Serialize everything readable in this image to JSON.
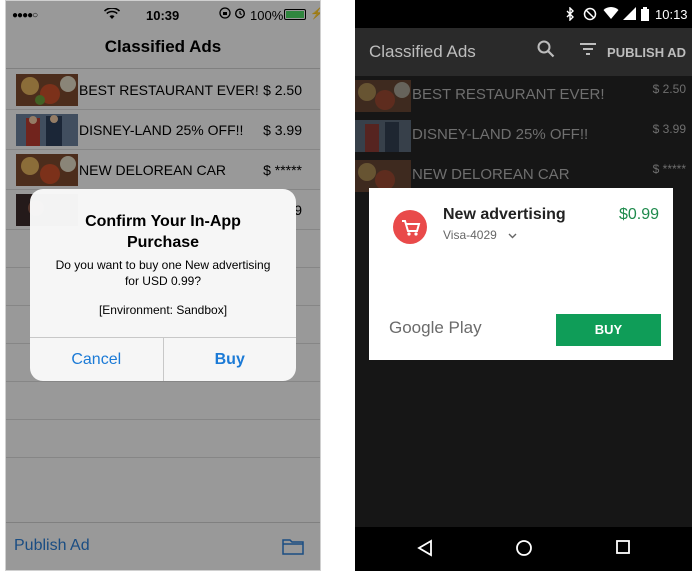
{
  "ios": {
    "status": {
      "signal": "●●●●○",
      "time": "10:39",
      "battery": "100%"
    },
    "title": "Classified Ads",
    "list": [
      {
        "title": "BEST RESTAURANT EVER!",
        "price": "$ 2.50",
        "image": "food-image"
      },
      {
        "title": "DISNEY-LAND 25% OFF!!",
        "price": "$ 3.99",
        "image": "disney-image"
      },
      {
        "title": "NEW DELOREAN CAR",
        "price": "$ *****",
        "image": "food-image"
      },
      {
        "title": "",
        "price": "9",
        "image": "person-image"
      }
    ],
    "alert": {
      "title": "Confirm Your In-App Purchase",
      "message": "Do you want to buy one New advertising for USD 0.99?",
      "environment": "[Environment: Sandbox]",
      "cancel": "Cancel",
      "buy": "Buy"
    },
    "tab": {
      "publish": "Publish Ad",
      "icon": "folder-icon"
    }
  },
  "android": {
    "status": {
      "time": "10:13"
    },
    "title": "Classified Ads",
    "publish": "PUBLISH AD",
    "list": [
      {
        "title": "BEST RESTAURANT EVER!",
        "price": "$ 2.50"
      },
      {
        "title": "DISNEY-LAND 25% OFF!!",
        "price": "$ 3.99"
      },
      {
        "title": "NEW DELOREAN CAR",
        "price": "$ *****"
      }
    ],
    "purchase": {
      "product": "New advertising",
      "price": "$0.99",
      "payment": "Visa-4029",
      "brand": "Google Play",
      "buy": "BUY"
    }
  },
  "colors": {
    "ios_blue": "#1b7ad6",
    "gp_green": "#0f9d58",
    "icon_red": "#e94a4a"
  }
}
